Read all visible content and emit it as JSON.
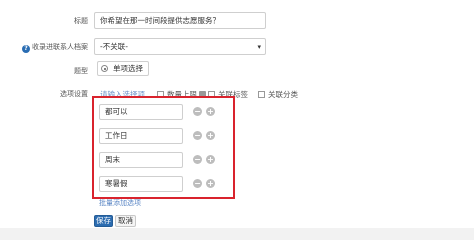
{
  "form": {
    "title_label": "标题",
    "title_value": "你希望在那一时间段提供志愿服务？",
    "archive_label": "收录进联系人档案",
    "archive_value": "-不关联-",
    "type_label": "题型",
    "type_value": "单项选择",
    "options_label": "选项设置",
    "option_placeholder_text": "请输入选择项",
    "checkboxes": [
      "数量上限",
      "关联标签",
      "关联分类"
    ],
    "options": [
      "都可以",
      "工作日",
      "周末",
      "寒暑假"
    ],
    "remove_symbol": "−",
    "add_symbol": "+",
    "batch_add_label": "批量添加选项",
    "save_label": "保存",
    "cancel_label": "取消"
  },
  "colors": {
    "highlight_box": "#d9232d",
    "primary_button": "#2c6cb0",
    "link": "#5b87c5"
  }
}
